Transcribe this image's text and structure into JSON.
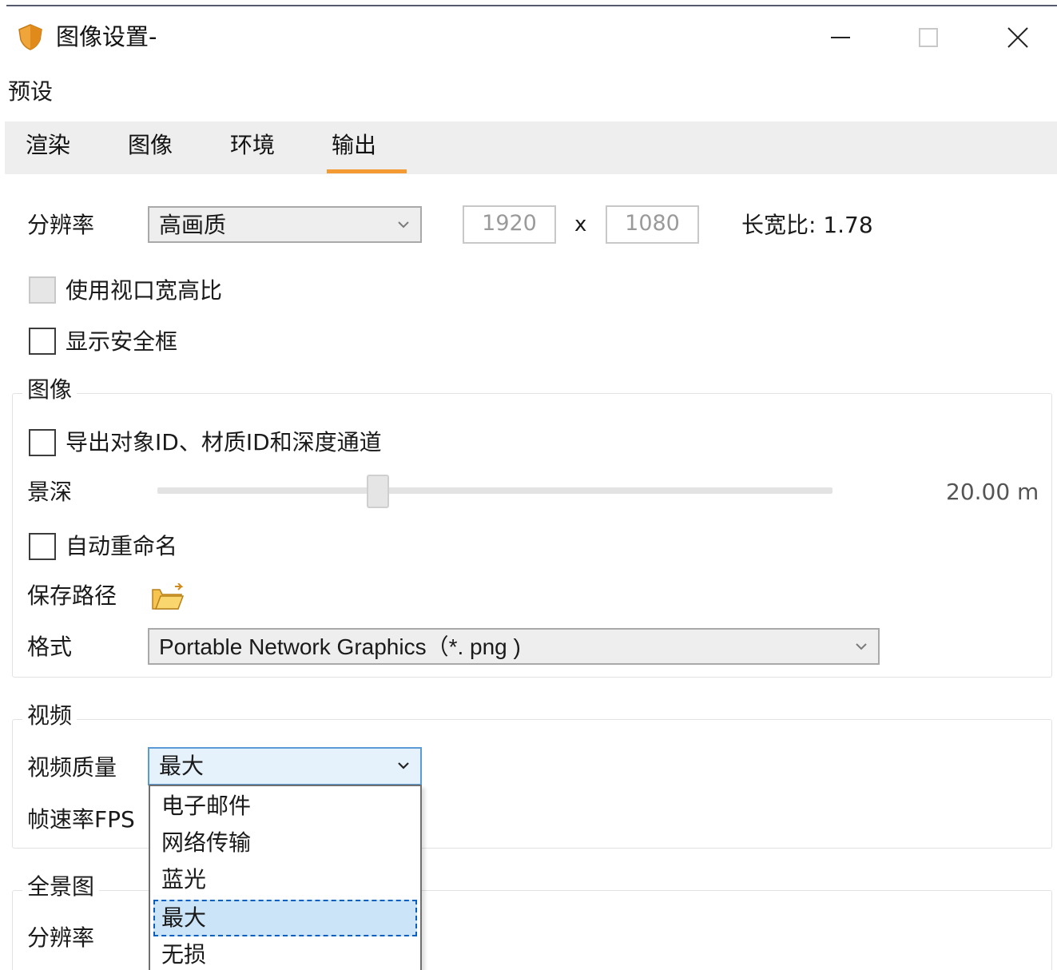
{
  "window": {
    "title": "图像设置-",
    "controls": {
      "minimize": "minimize-icon",
      "maximize": "maximize-icon",
      "close": "close-icon"
    }
  },
  "menu": {
    "items": [
      "预设"
    ]
  },
  "tabs": [
    {
      "label": "渲染",
      "active": false
    },
    {
      "label": "图像",
      "active": false
    },
    {
      "label": "环境",
      "active": false
    },
    {
      "label": "输出",
      "active": true
    }
  ],
  "resolution": {
    "label": "分辨率",
    "preset": "高画质",
    "width": "1920",
    "separator": "x",
    "height": "1080",
    "aspect": "长宽比: 1.78"
  },
  "checkboxes": {
    "use_viewport_aspect": {
      "label": "使用视口宽高比",
      "checked": false,
      "enabled": false
    },
    "show_safe_frame": {
      "label": "显示安全框",
      "checked": false,
      "enabled": true
    }
  },
  "image_group": {
    "title": "图像",
    "export_ids": {
      "label": "导出对象ID、材质ID和深度通道",
      "checked": false
    },
    "depth_of_field": {
      "label": "景深",
      "value": "20.00 m",
      "slider_fraction": 0.32
    },
    "auto_rename": {
      "label": "自动重命名",
      "checked": false
    },
    "save_path": {
      "label": "保存路径"
    },
    "format": {
      "label": "格式",
      "value": "Portable Network Graphics（*. png )"
    }
  },
  "video_group": {
    "title": "视频",
    "quality": {
      "label": "视频质量",
      "value": "最大"
    },
    "fps": {
      "label": "帧速率FPS"
    },
    "quality_options": [
      "电子邮件",
      "网络传输",
      "蓝光",
      "最大",
      "无损"
    ],
    "selected_option": "最大"
  },
  "panorama_group": {
    "title": "全景图",
    "resolution": {
      "label": "分辨率"
    }
  },
  "colors": {
    "accent_tab_underline": "#f39a32",
    "selection_highlight": "#cce4f7",
    "focus_border": "#0a5fbf"
  }
}
